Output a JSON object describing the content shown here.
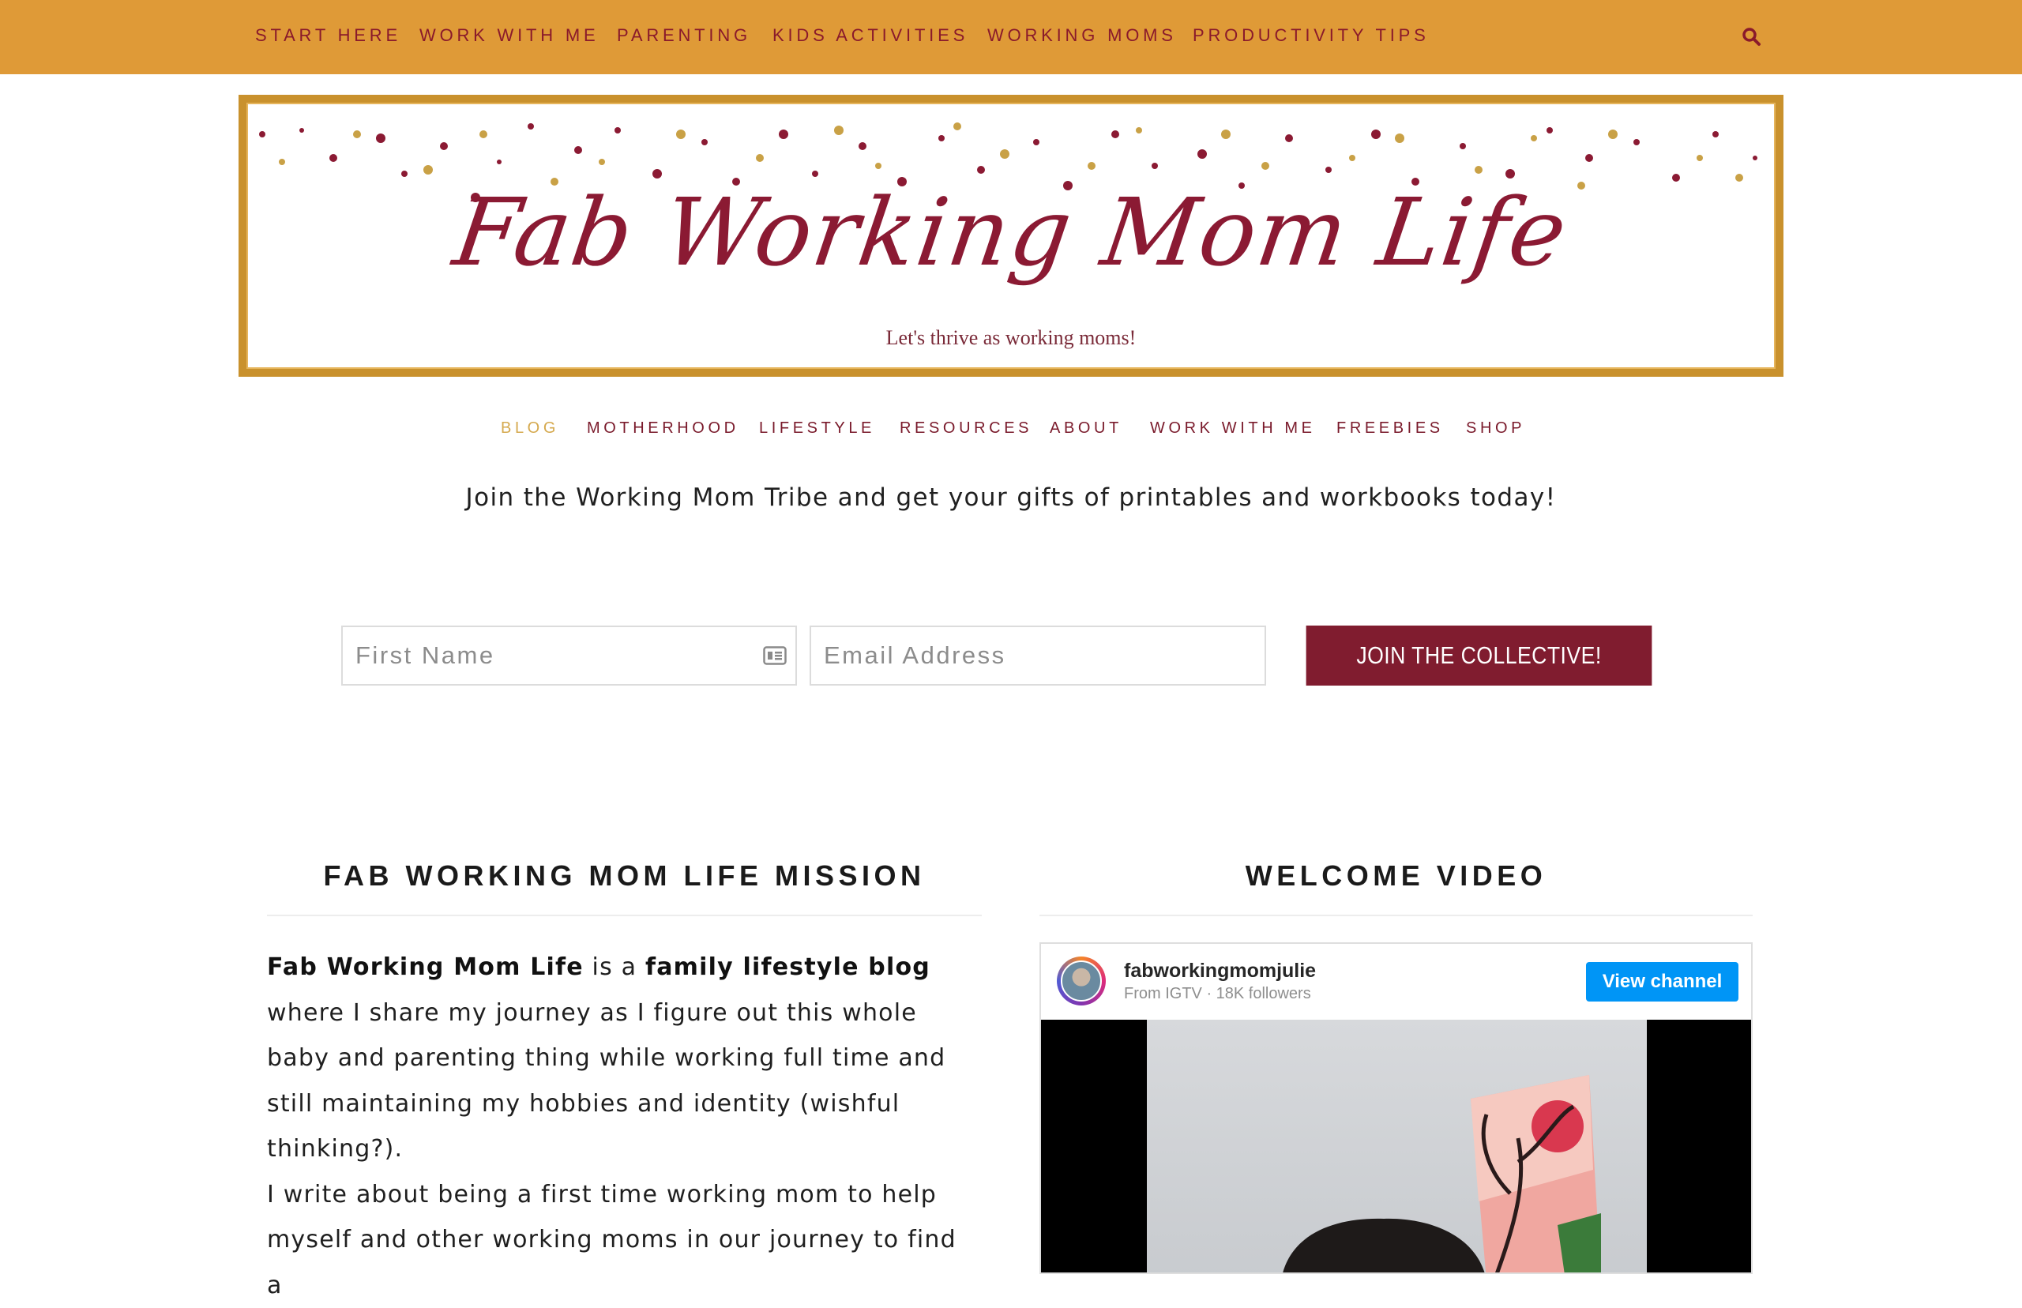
{
  "topnav": {
    "items": [
      "START HERE",
      "WORK WITH ME",
      "PARENTING",
      "KIDS ACTIVITIES",
      "WORKING MOMS",
      "PRODUCTIVITY TIPS"
    ],
    "search_icon": "search-icon"
  },
  "header": {
    "title": "Fab Working Mom Life",
    "tagline": "Let's thrive as working moms!"
  },
  "mainmenu": {
    "items": [
      "BLOG",
      "MOTHERHOOD",
      "LIFESTYLE",
      "RESOURCES",
      "ABOUT",
      "WORK WITH ME",
      "FREEBIES",
      "SHOP"
    ],
    "active": "BLOG"
  },
  "signup": {
    "intro": "Join the Working Mom Tribe and get your gifts of printables and workbooks today!",
    "first_name_placeholder": "First Name",
    "email_placeholder": "Email Address",
    "button": "JOIN THE COLLECTIVE!"
  },
  "mission": {
    "title": "FAB WORKING MOM LIFE MISSION",
    "p1_bold1": "Fab Working Mom Life",
    "p1_text1": " is a ",
    "p1_bold2": "family lifestyle blog",
    "p1_text2": " where I share my journey as I figure out this whole baby and parenting thing while working full time and still maintaining my hobbies and identity (wishful thinking?).",
    "p2": "I write about being a first time working mom to help myself and other working moms in our journey to find a"
  },
  "video": {
    "title": "WELCOME VIDEO",
    "username": "fabworkingmomjulie",
    "source": "From IGTV · 18K followers",
    "button": "View channel"
  },
  "colors": {
    "topbar": "#df9a37",
    "accent": "#801c2f",
    "brand_text": "#8b1a33",
    "gold_border": "#c9912d",
    "active_menu": "#d5a94e",
    "instagram_blue": "#0095f6"
  }
}
